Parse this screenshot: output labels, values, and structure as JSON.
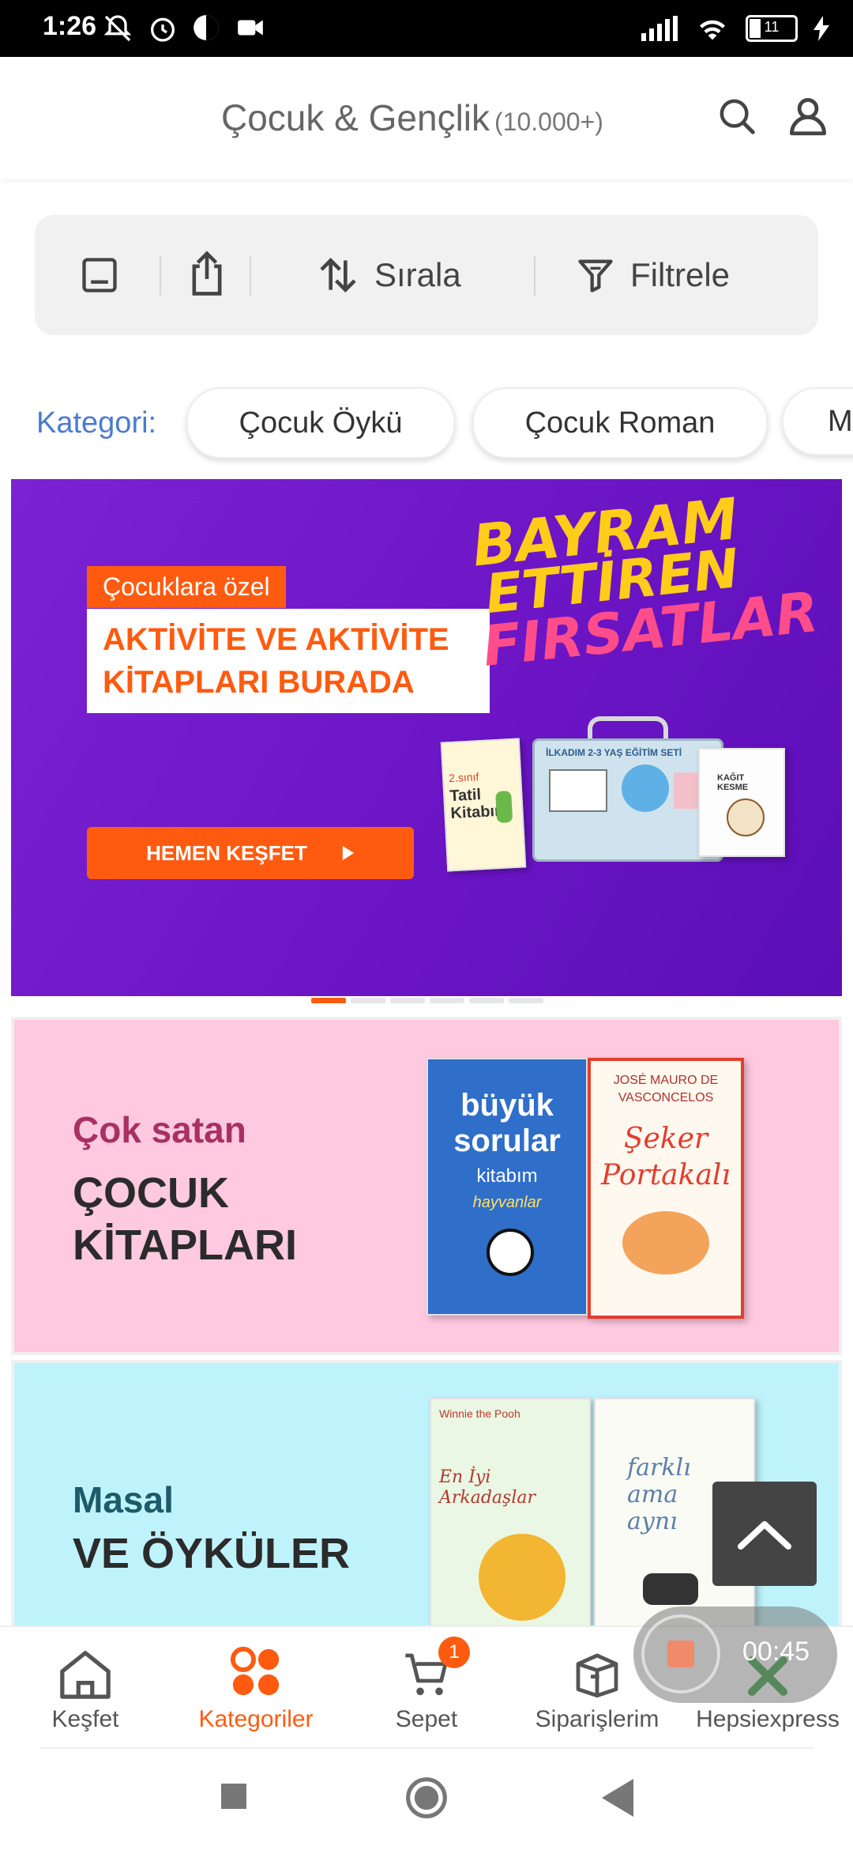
{
  "status_bar": {
    "time": "1:26",
    "battery": "11"
  },
  "header": {
    "title": "Çocuk & Gençlik",
    "count": "(10.000+)"
  },
  "toolbar": {
    "sort_label": "Sırala",
    "filter_label": "Filtrele"
  },
  "categories": {
    "label": "Kategori:",
    "chips": [
      "Çocuk Öykü",
      "Çocuk Roman",
      "M"
    ]
  },
  "hero": {
    "tag": "Çocuklara özel",
    "headline_line1": "AKTİVİTE VE AKTİVİTE",
    "headline_line2": "KİTAPLARI BURADA",
    "cta": "HEMEN KEŞFET",
    "promo_line1": "BAYRAM",
    "promo_line2": "ETTİREN",
    "promo_line3": "FIRSATLAR",
    "book1": "Tatil Kitabım",
    "book1_sub": "2.sınıf",
    "book2": "İLKADIM 2-3 YAŞ EĞİTİM SETİ",
    "book3": "KAĞIT KESME",
    "slides_total": 6,
    "slides_active": 1
  },
  "banner_bestseller": {
    "line1": "Çok satan",
    "line2a": "ÇOCUK",
    "line2b": "KİTAPLARI",
    "book_left_title": "büyük sorular",
    "book_left_sub": "kitabım",
    "book_left_topic": "hayvanlar",
    "book_right_author": "JOSÉ MAURO DE VASCONCELOS",
    "book_right_title": "Şeker Portakalı"
  },
  "banner_tales": {
    "line1": "Masal",
    "line2": "VE ÖYKÜLER",
    "book_left_title": "En İyi Arkadaşlar",
    "book_left_brand": "Winnie the Pooh",
    "book_right_title": "farklı ama aynı"
  },
  "recording": {
    "timer": "00:45"
  },
  "bottom_nav": {
    "items": [
      {
        "label": "Keşfet"
      },
      {
        "label": "Kategoriler"
      },
      {
        "label": "Sepet",
        "badge": "1"
      },
      {
        "label": "Siparişlerim"
      },
      {
        "label": "Hepsiexpress"
      }
    ],
    "active_index": 1
  },
  "colors": {
    "accent": "#ff5b10",
    "hero_bg": "#6a14c4",
    "link_blue": "#4a7bd0",
    "pink_banner": "#ffc9e0",
    "cyan_banner": "#bff3fb"
  }
}
